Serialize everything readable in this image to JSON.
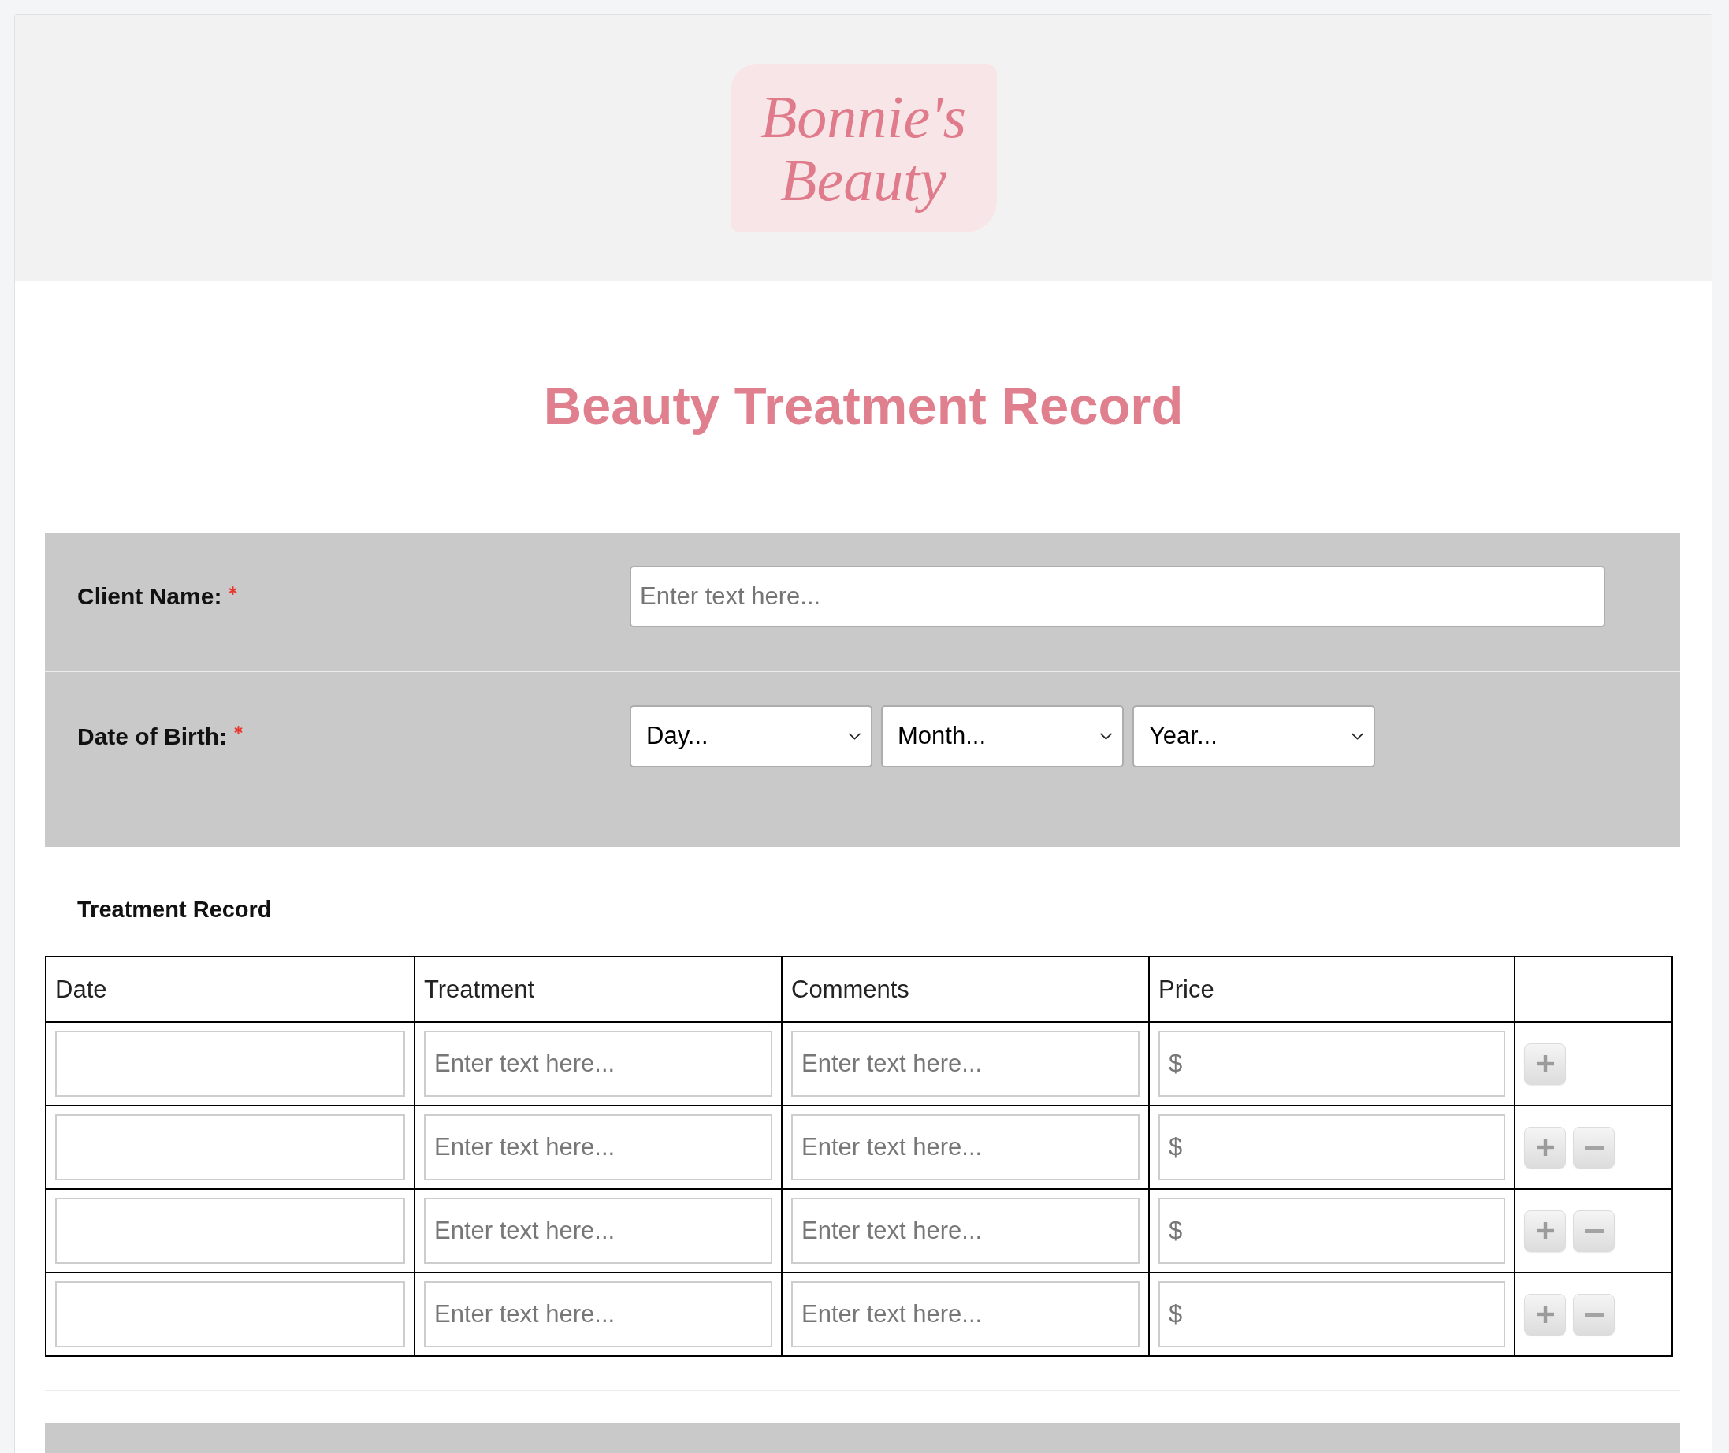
{
  "header": {
    "logo": {
      "lines": [
        "Bonnie's",
        "Beauty"
      ]
    }
  },
  "title": "Beauty Treatment Record",
  "fields": [
    {
      "kind": "text",
      "label": "Client Name:",
      "required": true,
      "placeholder": "Enter text here..."
    },
    {
      "kind": "date",
      "label": "Date of Birth:",
      "required": true,
      "selects": [
        {
          "value": "Day..."
        },
        {
          "value": "Month..."
        },
        {
          "value": "Year..."
        }
      ]
    }
  ],
  "treatment_record": {
    "heading": "Treatment Record",
    "table": {
      "columns": [
        {
          "label": "Date"
        },
        {
          "label": "Treatment"
        },
        {
          "label": "Comments"
        },
        {
          "label": "Price"
        }
      ],
      "rows": [
        {
          "cells": [
            {},
            {
              "placeholder": "Enter text here..."
            },
            {
              "placeholder": "Enter text here..."
            },
            {
              "placeholder": "$"
            }
          ],
          "actions": [
            {
              "kind": "add"
            }
          ]
        },
        {
          "cells": [
            {},
            {
              "placeholder": "Enter text here..."
            },
            {
              "placeholder": "Enter text here..."
            },
            {
              "placeholder": "$"
            }
          ],
          "actions": [
            {
              "kind": "add"
            },
            {
              "kind": "remove"
            }
          ]
        },
        {
          "cells": [
            {},
            {
              "placeholder": "Enter text here..."
            },
            {
              "placeholder": "Enter text here..."
            },
            {
              "placeholder": "$"
            }
          ],
          "actions": [
            {
              "kind": "add"
            },
            {
              "kind": "remove"
            }
          ]
        },
        {
          "cells": [
            {},
            {
              "placeholder": "Enter text here..."
            },
            {
              "placeholder": "Enter text here..."
            },
            {
              "placeholder": "$"
            }
          ],
          "actions": [
            {
              "kind": "add"
            },
            {
              "kind": "remove"
            }
          ]
        }
      ]
    }
  }
}
